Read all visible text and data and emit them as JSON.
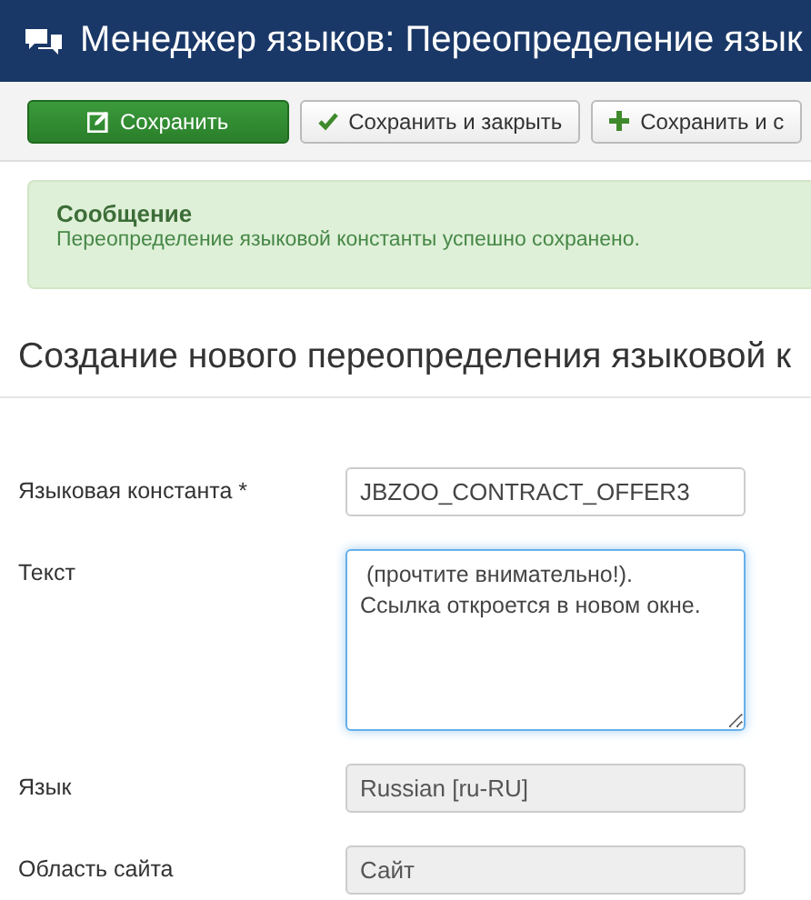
{
  "header": {
    "title": "Менеджер языков: Переопределение язык"
  },
  "toolbar": [
    {
      "label": "Сохранить",
      "kind": "primary"
    },
    {
      "label": "Сохранить и закрыть",
      "kind": "check"
    },
    {
      "label": "Сохранить и с",
      "kind": "plus"
    }
  ],
  "message": {
    "title": "Сообщение",
    "text": "Переопределение языковой константы успешно сохранено."
  },
  "heading": "Создание нового переопределения языковой к",
  "fields": [
    {
      "label": "Языковая константа *",
      "value": "JBZOO_CONTRACT_OFFER3",
      "kind": "input",
      "disabled": false,
      "focused": false
    },
    {
      "label": "Текст",
      "value": " (прочтите внимательно!).\nСсылка откроется в новом окне.",
      "kind": "textarea",
      "disabled": false,
      "focused": true
    },
    {
      "label": "Язык",
      "value": "Russian [ru-RU]",
      "kind": "input",
      "disabled": true,
      "focused": false
    },
    {
      "label": "Область сайта",
      "value": "Сайт",
      "kind": "input",
      "disabled": true,
      "focused": false
    }
  ]
}
